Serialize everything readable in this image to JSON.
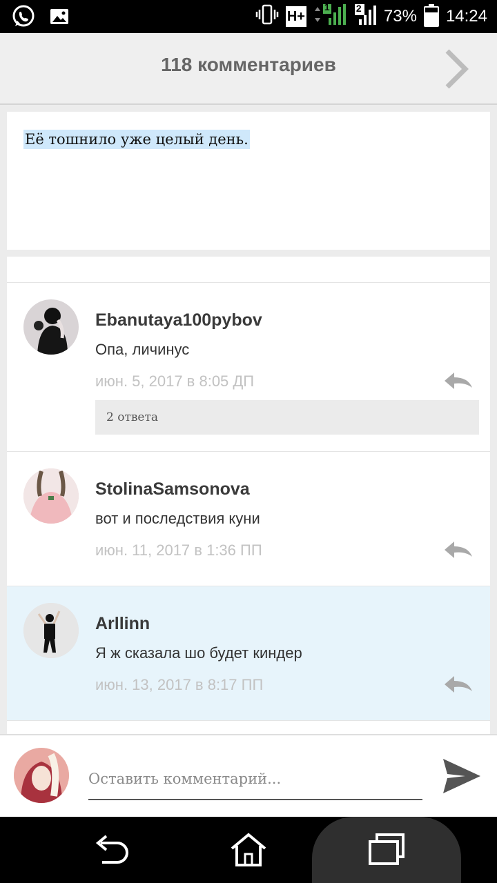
{
  "status_bar": {
    "battery_text": "73%",
    "battery_level": 0.73,
    "time": "14:24",
    "network_badge": "H+",
    "sim1": "1",
    "sim2": "2",
    "icons": [
      "whatsapp-icon",
      "gallery-icon",
      "vibrate-icon",
      "signal-icon",
      "battery-icon"
    ]
  },
  "header": {
    "title": "118 комментариев",
    "next_icon": "chevron-right-icon"
  },
  "post": {
    "text": "Её тошнило уже целый день."
  },
  "comments": [
    {
      "author": "Ebanutaya100pybov",
      "text": "Опа, личинус",
      "date": "июн. 5, 2017 в 8:05 ДП",
      "replies_label": "2 ответа",
      "highlighted": false
    },
    {
      "author": "StolinaSamsonova",
      "text": "вот и последствия куни",
      "date": "июн. 11, 2017 в 1:36 ПП",
      "highlighted": false
    },
    {
      "author": "Arllinn",
      "text": "Я ж сказала шо будет киндер",
      "date": "июн. 13, 2017 в 8:17 ПП",
      "highlighted": true
    }
  ],
  "input": {
    "placeholder": "Оставить комментарий...",
    "value": ""
  },
  "colors": {
    "highlight": "#e7f4fb",
    "selection": "#cfe8fb",
    "header_bg": "#efefef"
  }
}
